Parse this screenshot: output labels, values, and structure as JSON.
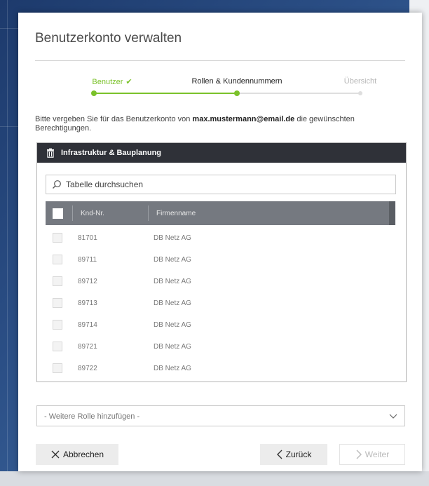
{
  "dialog": {
    "title": "Benutzerkonto verwalten"
  },
  "stepper": {
    "steps": [
      {
        "label": "Benutzer",
        "state": "done"
      },
      {
        "label": "Rollen & Kundennummern",
        "state": "active"
      },
      {
        "label": "Übersicht",
        "state": "pending"
      }
    ],
    "done_icon": "checkmark-icon",
    "accent_color": "#7bc22a"
  },
  "intro": {
    "before": "Bitte vergeben Sie für das Benutzerkonto von ",
    "email": "max.mustermann@email.de",
    "after": " die gewünschten Berechtigungen."
  },
  "panel": {
    "header": "Infrastruktur & Bauplanung",
    "header_icon": "trash-icon",
    "search_placeholder": "Tabelle durchsuchen",
    "columns": [
      "Knd-Nr.",
      "Firmenname"
    ],
    "rows": [
      {
        "knd": "81701",
        "firma": "DB Netz AG"
      },
      {
        "knd": "89711",
        "firma": "DB Netz AG"
      },
      {
        "knd": "89712",
        "firma": "DB Netz AG"
      },
      {
        "knd": "89713",
        "firma": "DB Netz AG"
      },
      {
        "knd": "89714",
        "firma": "DB Netz AG"
      },
      {
        "knd": "89721",
        "firma": "DB Netz AG"
      },
      {
        "knd": "89722",
        "firma": "DB Netz AG"
      }
    ]
  },
  "role_select": {
    "placeholder": "- Weitere Rolle hinzufügen -"
  },
  "footer": {
    "cancel_label": "Abbrechen",
    "back_label": "Zurück",
    "next_label": "Weiter"
  }
}
